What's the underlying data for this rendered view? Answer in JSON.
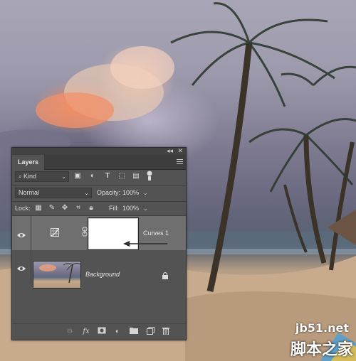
{
  "panel": {
    "title": "Layers",
    "filter": {
      "label": "Kind"
    },
    "blend_mode": "Normal",
    "opacity_label": "Opacity:",
    "opacity_value": "100%",
    "lock_label": "Lock:",
    "fill_label": "Fill:",
    "fill_value": "100%",
    "layers": [
      {
        "name": "Curves 1",
        "type": "adjustment",
        "selected": true
      },
      {
        "name": "Background",
        "type": "image",
        "locked": true
      }
    ],
    "footer_icons": [
      "link-icon",
      "fx-icon",
      "mask-icon",
      "adjustment-icon",
      "folder-icon",
      "new-layer-icon",
      "trash-icon"
    ]
  },
  "watermark": {
    "site": "jb51.net",
    "text": "脚本之家"
  },
  "colors": {
    "panel_bg": "#535353",
    "selected_layer": "#6f6f6f",
    "titlebar": "#424242"
  }
}
